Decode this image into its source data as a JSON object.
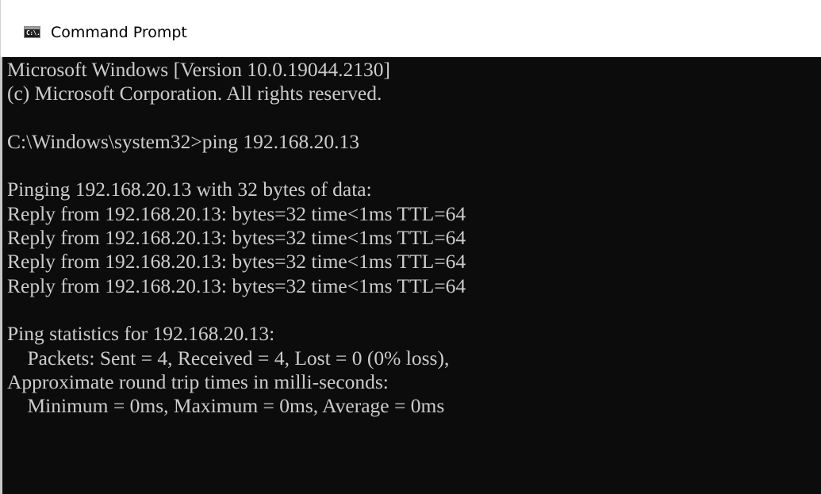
{
  "window": {
    "title": "Command Prompt",
    "icon": "cmd-icon",
    "icon_label": "C:\\."
  },
  "console": {
    "lines": [
      "Microsoft Windows [Version 10.0.19044.2130]",
      "(c) Microsoft Corporation. All rights reserved.",
      "",
      "C:\\Windows\\system32>ping 192.168.20.13",
      "",
      "Pinging 192.168.20.13 with 32 bytes of data:",
      "Reply from 192.168.20.13: bytes=32 time<1ms TTL=64",
      "Reply from 192.168.20.13: bytes=32 time<1ms TTL=64",
      "Reply from 192.168.20.13: bytes=32 time<1ms TTL=64",
      "Reply from 192.168.20.13: bytes=32 time<1ms TTL=64",
      "",
      "Ping statistics for 192.168.20.13:",
      "    Packets: Sent = 4, Received = 4, Lost = 0 (0% loss),",
      "Approximate round trip times in milli-seconds:",
      "    Minimum = 0ms, Maximum = 0ms, Average = 0ms"
    ]
  },
  "colors": {
    "console_background": "#0c0c0c",
    "console_text": "#cccccc",
    "titlebar_background": "#ffffff"
  }
}
